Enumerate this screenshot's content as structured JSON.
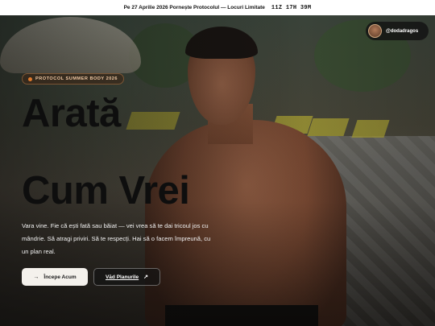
{
  "announcement": {
    "text": "Pe 27 Aprilie 2026 Pornește Protocolul — Locuri Limitate",
    "countdown": "11Z 17H 39M"
  },
  "instagram": {
    "handle": "@dodadragos"
  },
  "hero": {
    "badge": "PROTOCOL SUMMER BODY 2026",
    "title_line1": "Arată",
    "title_line2": "Cum Vrei",
    "lead": "Vara vine. Fie că ești fată sau băiat — vei vrea să te dai tricoul jos cu mândrie. Să atragi priviri. Să te respecți. Hai să o facem împreună, cu un plan real.",
    "primary_button": "Începe Acum",
    "primary_icon": "arrow-right-icon",
    "secondary_button": "Văd Planurile",
    "secondary_icon": "arrow-up-right-icon"
  },
  "colors": {
    "accent": "#e07a2c",
    "topbar_bg": "#ffffff",
    "title": "#0e0e0e"
  }
}
